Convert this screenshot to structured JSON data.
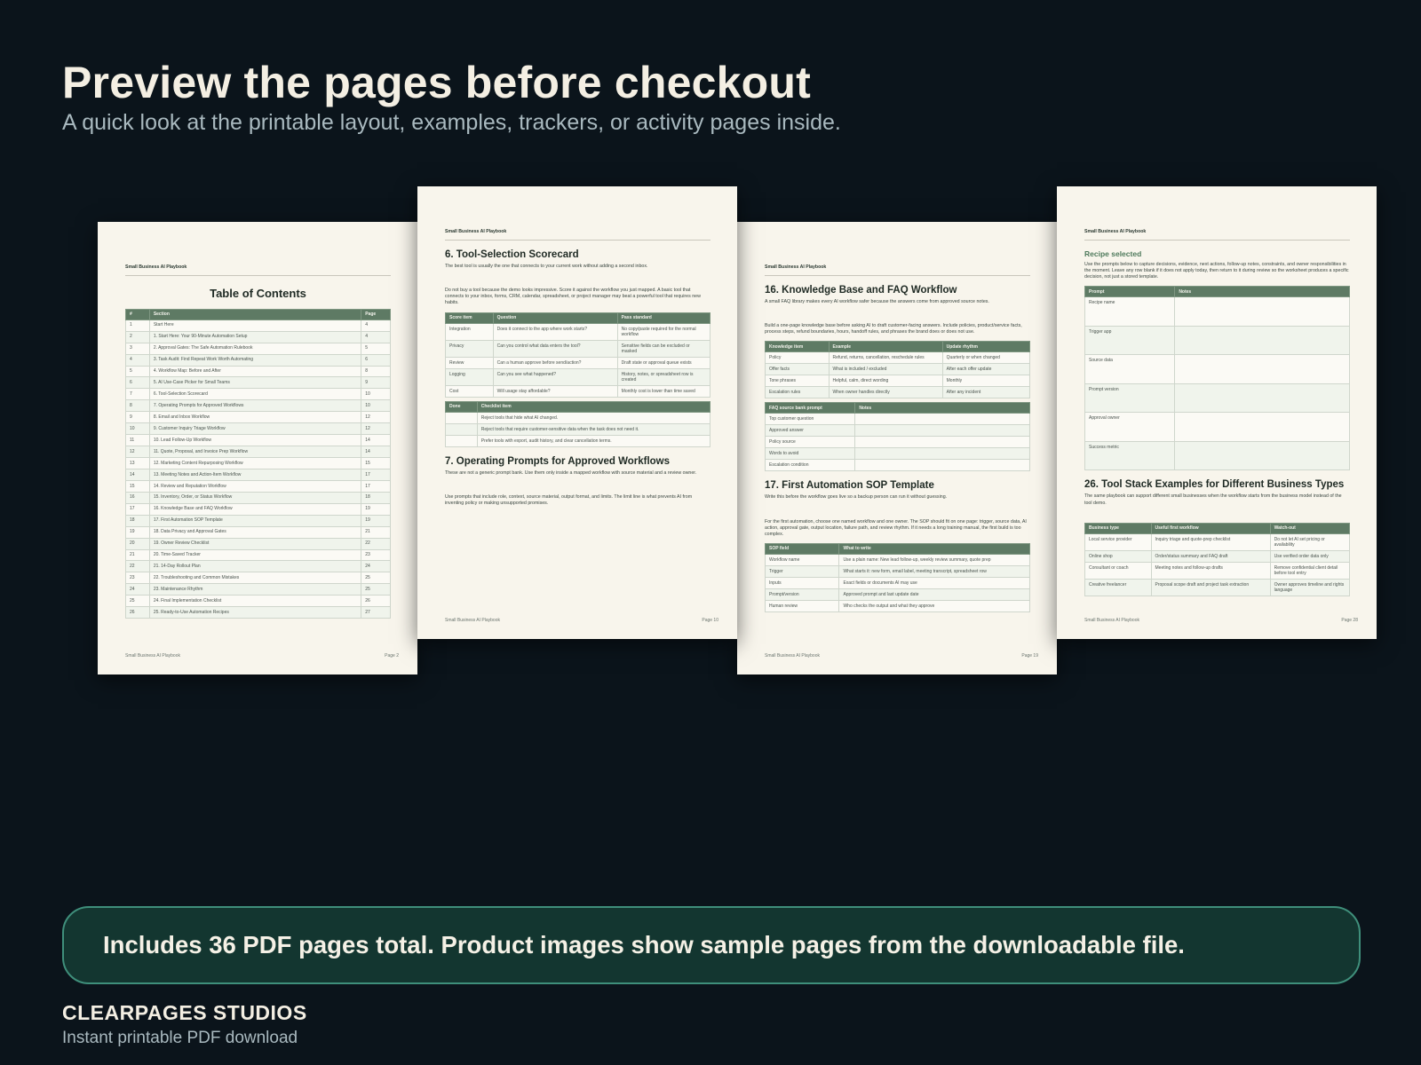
{
  "hero": {
    "title": "Preview the pages before checkout",
    "subtitle": "A quick look at the printable layout, examples, trackers, or activity pages inside."
  },
  "pages": {
    "toc": {
      "header": "Small Business AI Playbook",
      "title": "Table of Contents",
      "columns": [
        "#",
        "Section",
        "Page"
      ],
      "rows": [
        [
          "1",
          "Start Here",
          "4"
        ],
        [
          "2",
          "1. Start Here: Your 90-Minute Automation Setup",
          "4"
        ],
        [
          "3",
          "2. Approval Gates: The Safe Automation Rulebook",
          "5"
        ],
        [
          "4",
          "3. Task Audit: Find Repeat Work Worth Automating",
          "6"
        ],
        [
          "5",
          "4. Workflow Map: Before and After",
          "8"
        ],
        [
          "6",
          "5. AI Use-Case Picker for Small Teams",
          "9"
        ],
        [
          "7",
          "6. Tool-Selection Scorecard",
          "10"
        ],
        [
          "8",
          "7. Operating Prompts for Approved Workflows",
          "10"
        ],
        [
          "9",
          "8. Email and Inbox Workflow",
          "12"
        ],
        [
          "10",
          "9. Customer Inquiry Triage Workflow",
          "12"
        ],
        [
          "11",
          "10. Lead Follow-Up Workflow",
          "14"
        ],
        [
          "12",
          "11. Quote, Proposal, and Invoice Prep Workflow",
          "14"
        ],
        [
          "13",
          "12. Marketing Content Repurposing Workflow",
          "15"
        ],
        [
          "14",
          "13. Meeting Notes and Action-Item Workflow",
          "17"
        ],
        [
          "15",
          "14. Review and Reputation Workflow",
          "17"
        ],
        [
          "16",
          "15. Inventory, Order, or Status Workflow",
          "18"
        ],
        [
          "17",
          "16. Knowledge Base and FAQ Workflow",
          "19"
        ],
        [
          "18",
          "17. First Automation SOP Template",
          "19"
        ],
        [
          "19",
          "18. Data Privacy and Approval Gates",
          "21"
        ],
        [
          "20",
          "19. Owner Review Checklist",
          "22"
        ],
        [
          "21",
          "20. Time-Saved Tracker",
          "23"
        ],
        [
          "22",
          "21. 14-Day Rollout Plan",
          "24"
        ],
        [
          "23",
          "22. Troubleshooting and Common Mistakes",
          "25"
        ],
        [
          "24",
          "23. Maintenance Rhythm",
          "25"
        ],
        [
          "25",
          "24. Final Implementation Checklist",
          "26"
        ],
        [
          "26",
          "25. Ready-to-Use Automation Recipes",
          "27"
        ]
      ],
      "footer_left": "Small Business AI Playbook",
      "footer_right": "Page 2"
    },
    "page10": {
      "header": "Small Business AI Playbook",
      "h1": "6. Tool-Selection Scorecard",
      "p1": "The best tool is usually the one that connects to your current work without adding a second inbox.",
      "p2": "Do not buy a tool because the demo looks impressive. Score it against the workflow you just mapped. A basic tool that connects to your inbox, forms, CRM, calendar, spreadsheet, or project manager may beat a powerful tool that requires new habits.",
      "t1_columns": [
        "Score item",
        "Question",
        "Pass standard"
      ],
      "t1_rows": [
        [
          "Integration",
          "Does it connect to the app where work starts?",
          "No copy/paste required for the normal workflow"
        ],
        [
          "Privacy",
          "Can you control what data enters the tool?",
          "Sensitive fields can be excluded or masked"
        ],
        [
          "Review",
          "Can a human approve before send/action?",
          "Draft state or approval queue exists"
        ],
        [
          "Logging",
          "Can you see what happened?",
          "History, notes, or spreadsheet row is created"
        ],
        [
          "Cost",
          "Will usage stay affordable?",
          "Monthly cost is lower than time saved"
        ]
      ],
      "t2_columns": [
        "Done",
        "Checklist item"
      ],
      "t2_rows": [
        [
          "",
          "Reject tools that hide what AI changed."
        ],
        [
          "",
          "Reject tools that require customer-sensitive data when the task does not need it."
        ],
        [
          "",
          "Prefer tools with export, audit history, and clear cancellation terms."
        ]
      ],
      "h2": "7. Operating Prompts for Approved Workflows",
      "p3": "These are not a generic prompt bank. Use them only inside a mapped workflow with source material and a review owner.",
      "p4": "Use prompts that include role, context, source material, output format, and limits. The limit line is what prevents AI from inventing policy or making unsupported promises.",
      "footer_left": "Small Business AI Playbook",
      "footer_right": "Page 10"
    },
    "page19": {
      "header": "Small Business AI Playbook",
      "h1": "16. Knowledge Base and FAQ Workflow",
      "p1": "A small FAQ library makes every AI workflow safer because the answers come from approved source notes.",
      "p2": "Build a one-page knowledge base before asking AI to draft customer-facing answers. Include policies, product/service facts, process steps, refund boundaries, hours, handoff rules, and phrases the brand does or does not use.",
      "t1_columns": [
        "Knowledge item",
        "Example",
        "Update rhythm"
      ],
      "t1_rows": [
        [
          "Policy",
          "Refund, returns, cancellation, reschedule rules",
          "Quarterly or when changed"
        ],
        [
          "Offer facts",
          "What is included / excluded",
          "After each offer update"
        ],
        [
          "Tone phrases",
          "Helpful, calm, direct wording",
          "Monthly"
        ],
        [
          "Escalation rules",
          "When owner handles directly",
          "After any incident"
        ]
      ],
      "t2_columns": [
        "FAQ source bank prompt",
        "Notes"
      ],
      "t2_rows": [
        [
          "Top customer question",
          ""
        ],
        [
          "Approved answer",
          ""
        ],
        [
          "Policy source",
          ""
        ],
        [
          "Words to avoid",
          ""
        ],
        [
          "Escalation condition",
          ""
        ]
      ],
      "h2": "17. First Automation SOP Template",
      "p3": "Write this before the workflow goes live so a backup person can run it without guessing.",
      "p4": "For the first automation, choose one named workflow and one owner. The SOP should fit on one page: trigger, source data, AI action, approval gate, output location, failure path, and review rhythm. If it needs a long training manual, the first build is too complex.",
      "t3_columns": [
        "SOP field",
        "What to write"
      ],
      "t3_rows": [
        [
          "Workflow name",
          "Use a plain name: New lead follow-up, weekly review summary, quote prep"
        ],
        [
          "Trigger",
          "What starts it: new form, email label, meeting transcript, spreadsheet row"
        ],
        [
          "Inputs",
          "Exact fields or documents AI may use"
        ],
        [
          "Prompt/version",
          "Approved prompt and last update date"
        ],
        [
          "Human review",
          "Who checks the output and what they approve"
        ]
      ],
      "footer_left": "Small Business AI Playbook",
      "footer_right": "Page 19"
    },
    "page28": {
      "header": "Small Business AI Playbook",
      "h1": "Recipe selected",
      "p1": "Use the prompts below to capture decisions, evidence, next actions, follow-up notes, constraints, and owner responsibilities in the moment. Leave any row blank if it does not apply today, then return to it during review so the worksheet produces a specific decision, not just a stored template.",
      "t1_columns": [
        "Prompt",
        "Notes"
      ],
      "t1_rows": [
        [
          "Recipe name",
          ""
        ],
        [
          "Trigger app",
          ""
        ],
        [
          "Source data",
          ""
        ],
        [
          "Prompt version",
          ""
        ],
        [
          "Approval owner",
          ""
        ],
        [
          "Success metric",
          ""
        ]
      ],
      "h2": "26. Tool Stack Examples for Different Business Types",
      "p2": "The same playbook can support different small businesses when the workflow starts from the business model instead of the tool demo.",
      "t2_columns": [
        "Business type",
        "Useful first workflow",
        "Watch-out"
      ],
      "t2_rows": [
        [
          "Local service provider",
          "Inquiry triage and quote-prep checklist",
          "Do not let AI set pricing or availability"
        ],
        [
          "Online shop",
          "Order/status summary and FAQ draft",
          "Use verified order data only"
        ],
        [
          "Consultant or coach",
          "Meeting notes and follow-up drafts",
          "Remove confidential client detail before tool entry"
        ],
        [
          "Creative freelancer",
          "Proposal scope draft and project task extraction",
          "Owner approves timeline and rights language"
        ]
      ],
      "footer_left": "Small Business AI Playbook",
      "footer_right": "Page 28"
    }
  },
  "note": {
    "text": "Includes 36 PDF pages total. Product images show sample pages from the downloadable file."
  },
  "brand": {
    "name": "CLEARPAGES STUDIOS",
    "tagline": "Instant printable PDF download"
  },
  "colors": {
    "background": "#0b141b",
    "page": "#f8f5ec",
    "table_header": "#5e7a64",
    "note_bg": "#133630",
    "note_border": "#3f8f7b"
  }
}
